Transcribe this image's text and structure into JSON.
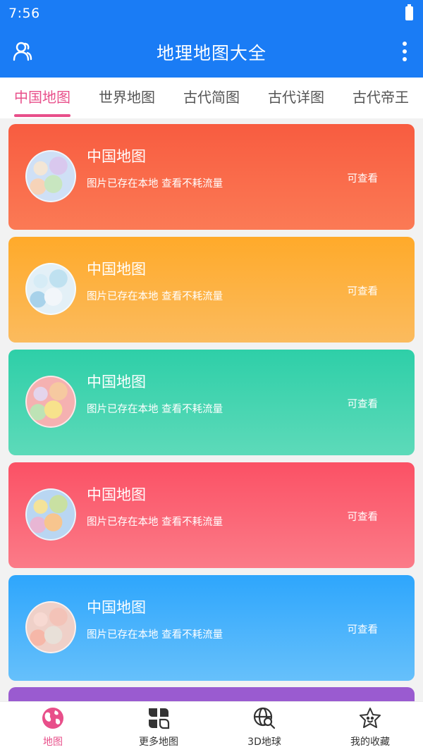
{
  "status": {
    "time": "7:56"
  },
  "header": {
    "title": "地理地图大全",
    "profile_icon": "user-group-icon",
    "more_icon": "more-vertical-icon"
  },
  "tabs": [
    {
      "label": "中国地图",
      "active": true
    },
    {
      "label": "世界地图",
      "active": false
    },
    {
      "label": "古代简图",
      "active": false
    },
    {
      "label": "古代详图",
      "active": false
    },
    {
      "label": "古代帝王",
      "active": false
    }
  ],
  "cards": [
    {
      "title": "中国地图",
      "desc": "图片已存在本地 查看不耗流量",
      "action": "可查看",
      "gradient": [
        "#f85c40",
        "#fb7a55"
      ]
    },
    {
      "title": "中国地图",
      "desc": "图片已存在本地 查看不耗流量",
      "action": "可查看",
      "gradient": [
        "#ffaa2a",
        "#fbbb5e"
      ]
    },
    {
      "title": "中国地图",
      "desc": "图片已存在本地 查看不耗流量",
      "action": "可查看",
      "gradient": [
        "#2ecfa8",
        "#5ddab9"
      ]
    },
    {
      "title": "中国地图",
      "desc": "图片已存在本地 查看不耗流量",
      "action": "可查看",
      "gradient": [
        "#fb5165",
        "#fb7b88"
      ]
    },
    {
      "title": "中国地图",
      "desc": "图片已存在本地 查看不耗流量",
      "action": "可查看",
      "gradient": [
        "#2ea6fc",
        "#66c0fb"
      ]
    }
  ],
  "bottom_nav": [
    {
      "label": "地图",
      "icon": "globe-icon",
      "active": true
    },
    {
      "label": "更多地图",
      "icon": "grid-leaf-icon",
      "active": false
    },
    {
      "label": "3D地球",
      "icon": "globe-search-icon",
      "active": false
    },
    {
      "label": "我的收藏",
      "icon": "star-face-icon",
      "active": false
    }
  ],
  "colors": {
    "primary": "#1a7cf5",
    "accent": "#e84f8a",
    "peek_card": "#9a5bd0"
  }
}
